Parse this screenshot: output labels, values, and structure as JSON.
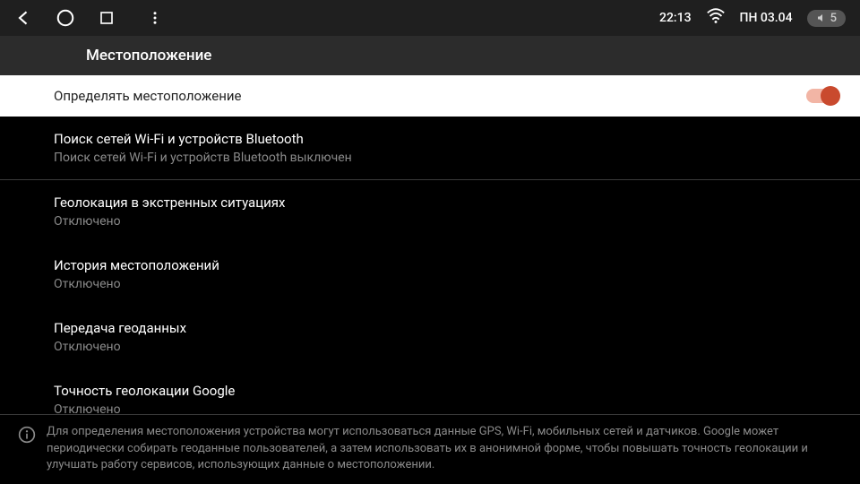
{
  "status": {
    "time": "22:13",
    "date": "ПН 03.04",
    "volume": "5"
  },
  "header": {
    "title": "Местоположение"
  },
  "toggle": {
    "label": "Определять местоположение"
  },
  "items": [
    {
      "title": "Поиск сетей Wi-Fi и устройств Bluetooth",
      "sub": "Поиск сетей Wi-Fi и устройств Bluetooth выключен"
    },
    {
      "title": "Геолокация в экстренных ситуациях",
      "sub": "Отключено"
    },
    {
      "title": "История местоположений",
      "sub": "Отключено"
    },
    {
      "title": "Передача геоданных",
      "sub": "Отключено"
    },
    {
      "title": "Точность геолокации Google",
      "sub": "Отключено"
    }
  ],
  "footer": {
    "text": "Для определения местоположения устройства могут использоваться данные GPS, Wi-Fi, мобильных сетей и датчиков. Google может периодически собирать геоданные пользователей, а затем использовать их в анонимной форме, чтобы повышать точность геолокации и улучшать работу сервисов, использующих данные о местоположении."
  }
}
